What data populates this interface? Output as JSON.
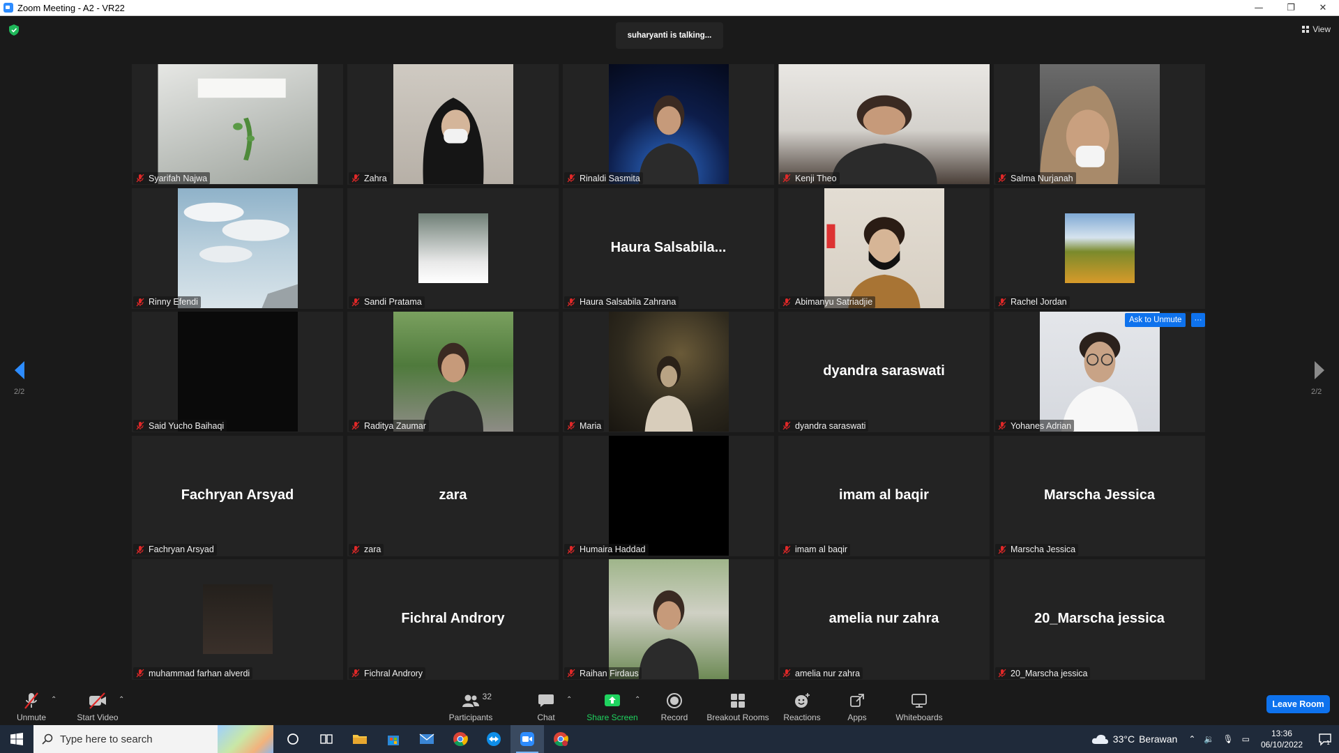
{
  "window": {
    "title": "Zoom Meeting - A2 - VR22"
  },
  "meeting": {
    "talking_indicator": "suharyanti is talking...",
    "view_label": "View",
    "page_left": "2/2",
    "page_right": "2/2"
  },
  "participants": [
    {
      "name": "Syarifah Najwa",
      "video": "wide-room",
      "display": ""
    },
    {
      "name": "Zahra",
      "video": "person-hijab",
      "display": ""
    },
    {
      "name": "Rinaldi Sasmita",
      "video": "person-space",
      "display": ""
    },
    {
      "name": "Kenji Theo",
      "video": "person-wide",
      "display": ""
    },
    {
      "name": "Salma Nurjanah",
      "video": "person-hijab2",
      "display": ""
    },
    {
      "name": "Rinny Efendi",
      "video": "sky",
      "display": ""
    },
    {
      "name": "Sandi Pratama",
      "video": "small-photo",
      "display": ""
    },
    {
      "name": "Haura Salsabila Zahrana",
      "video": "none",
      "display": "Haura  Salsabila..."
    },
    {
      "name": "Abimanyu Satriadjie",
      "video": "person-mask",
      "display": ""
    },
    {
      "name": "Rachel Jordan",
      "video": "small-field",
      "display": ""
    },
    {
      "name": "Said Yucho Baihaqi",
      "video": "dark",
      "display": ""
    },
    {
      "name": "Raditya Zaumar",
      "video": "outdoor",
      "display": ""
    },
    {
      "name": "Maria",
      "video": "dim-room",
      "display": ""
    },
    {
      "name": "dyandra saraswati",
      "video": "none",
      "display": "dyandra saraswati"
    },
    {
      "name": "Yohanes Adrian",
      "video": "person-glasses",
      "display": "",
      "ask_unmute": "Ask to Unmute",
      "more": "···"
    },
    {
      "name": "Fachryan Arsyad",
      "video": "none",
      "display": "Fachryan Arsyad"
    },
    {
      "name": "zara",
      "video": "none",
      "display": "zara"
    },
    {
      "name": "Humaira Haddad",
      "video": "black",
      "display": ""
    },
    {
      "name": "imam al baqir",
      "video": "none",
      "display": "imam al baqir"
    },
    {
      "name": "Marscha Jessica",
      "video": "none",
      "display": "Marscha Jessica"
    },
    {
      "name": "muhammad farhan alverdi",
      "video": "small-couple",
      "display": ""
    },
    {
      "name": "Fichral Androry",
      "video": "none",
      "display": "Fichral Androry"
    },
    {
      "name": "Raihan Firdaus",
      "video": "house",
      "display": ""
    },
    {
      "name": "amelia nur zahra",
      "video": "none",
      "display": "amelia nur zahra"
    },
    {
      "name": "20_Marscha jessica",
      "video": "none",
      "display": "20_Marscha jessica"
    }
  ],
  "toolbar": {
    "unmute": "Unmute",
    "start_video": "Start Video",
    "participants": "Participants",
    "participants_count": "32",
    "chat": "Chat",
    "share_screen": "Share Screen",
    "record": "Record",
    "breakout_rooms": "Breakout Rooms",
    "reactions": "Reactions",
    "apps": "Apps",
    "whiteboards": "Whiteboards",
    "leave_room": "Leave Room"
  },
  "taskbar": {
    "search_placeholder": "Type here to search",
    "weather_temp": "33°C",
    "weather_desc": "Berawan",
    "time": "13:36",
    "date": "06/10/2022",
    "notification_count": "1"
  },
  "colors": {
    "accent_blue": "#0e72ed",
    "share_green": "#1fd35f",
    "mute_red": "#e02828",
    "tile_bg": "#232323"
  }
}
